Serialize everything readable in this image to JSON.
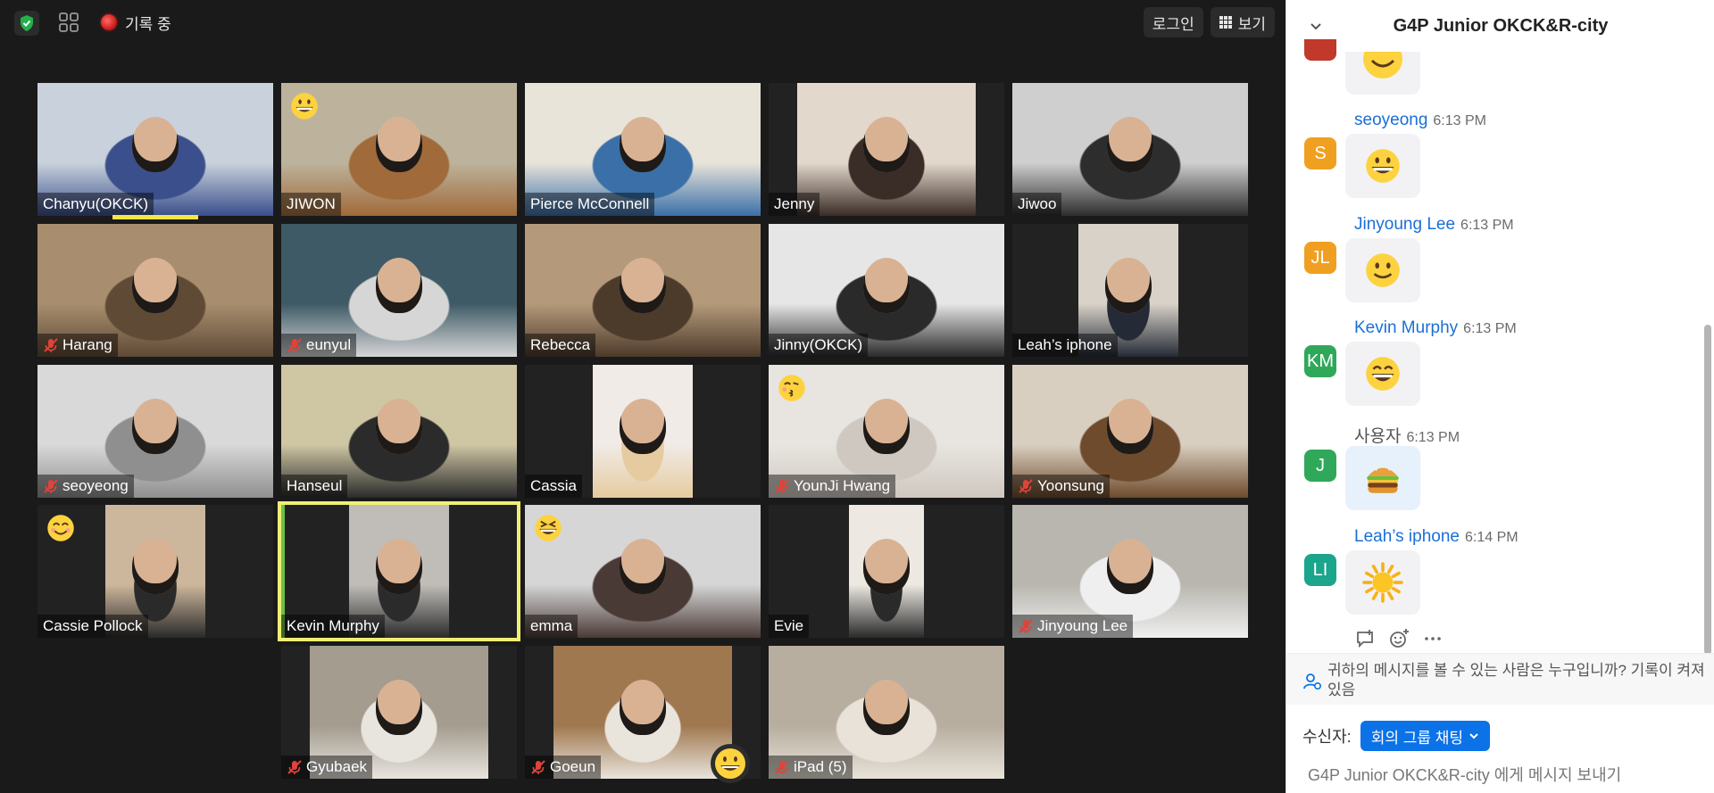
{
  "topbar": {
    "recording_label": "기록 중",
    "login_label": "로그인",
    "view_label": "보기"
  },
  "participants": [
    {
      "name": "Chanyu(OKCK)",
      "muted": false,
      "bg": [
        "#c9d2dc",
        "#3a4f8c"
      ],
      "reaction": ""
    },
    {
      "name": "JIWON",
      "muted": false,
      "bg": [
        "#bdb39c",
        "#a06a3a"
      ],
      "reaction": "grin"
    },
    {
      "name": "Pierce McConnell",
      "muted": false,
      "bg": [
        "#e9e4da",
        "#3a6fa8"
      ],
      "reaction": ""
    },
    {
      "name": "Jenny",
      "muted": false,
      "bg": [
        "#e3d8cc",
        "#3a2c26"
      ],
      "reaction": ""
    },
    {
      "name": "Jiwoo",
      "muted": false,
      "bg": [
        "#cfcfcf",
        "#2d2d2d"
      ],
      "reaction": ""
    },
    {
      "name": "Harang",
      "muted": true,
      "bg": [
        "#a88e6e",
        "#5f4a36"
      ],
      "reaction": ""
    },
    {
      "name": "eunyul",
      "muted": true,
      "bg": [
        "#3e5a66",
        "#d6d6d6"
      ],
      "reaction": ""
    },
    {
      "name": "Rebecca",
      "muted": false,
      "bg": [
        "#b49a7a",
        "#4c3a2a"
      ],
      "reaction": ""
    },
    {
      "name": "Jinny(OKCK)",
      "muted": false,
      "bg": [
        "#e6e6e6",
        "#2a2a2a"
      ],
      "reaction": ""
    },
    {
      "name": "Leah’s iphone",
      "muted": false,
      "bg": [
        "#d8d2c8",
        "#242a36"
      ],
      "reaction": ""
    },
    {
      "name": "seoyeong",
      "muted": true,
      "bg": [
        "#d9d9d9",
        "#8f8f8f"
      ],
      "reaction": ""
    },
    {
      "name": "Hanseul",
      "muted": false,
      "bg": [
        "#cfc6a4",
        "#2b2b2b"
      ],
      "reaction": ""
    },
    {
      "name": "Cassia",
      "muted": false,
      "bg": [
        "#f0ebe6",
        "#e6cba0"
      ],
      "reaction": ""
    },
    {
      "name": "YounJi Hwang",
      "muted": true,
      "bg": [
        "#e8e4df",
        "#cfc8c0"
      ],
      "reaction": "kiss"
    },
    {
      "name": "Yoonsung",
      "muted": true,
      "bg": [
        "#d9cfc0",
        "#6e4b2c"
      ],
      "reaction": ""
    },
    {
      "name": "Cassie Pollock",
      "muted": false,
      "bg": [
        "#cdb79c",
        "#2a2a2a"
      ],
      "reaction": "smile"
    },
    {
      "name": "Kevin Murphy",
      "muted": false,
      "bg": [
        "#c0bdb8",
        "#2b2b2b"
      ],
      "reaction": ""
    },
    {
      "name": "emma",
      "muted": false,
      "bg": [
        "#d6d6d6",
        "#4a3a36"
      ],
      "reaction": "laugh"
    },
    {
      "name": "Evie",
      "muted": false,
      "bg": [
        "#ede9e2",
        "#2a2a2a"
      ],
      "reaction": ""
    },
    {
      "name": "Jinyoung Lee",
      "muted": true,
      "bg": [
        "#b8b6ae",
        "#efefef"
      ],
      "reaction": ""
    },
    {
      "name": "Gyubaek",
      "muted": true,
      "bg": [
        "#a39c8f",
        "#e8e4de"
      ],
      "reaction": ""
    },
    {
      "name": "Goeun",
      "muted": true,
      "bg": [
        "#a07850",
        "#e9e4dc"
      ],
      "reaction": ""
    },
    {
      "name": "iPad (5)",
      "muted": true,
      "bg": [
        "#b7aea0",
        "#e8e2d8"
      ],
      "reaction": ""
    }
  ],
  "chat": {
    "title": "G4P Junior OKCK&R-city",
    "messages": [
      {
        "initials": "S",
        "name": "seoyeong",
        "time": "6:13 PM",
        "avatar_color": "#f0a020",
        "emoji": "grin"
      },
      {
        "initials": "JL",
        "name": "Jinyoung Lee",
        "time": "6:13 PM",
        "avatar_color": "#f0a020",
        "emoji": "slight-smile"
      },
      {
        "initials": "KM",
        "name": "Kevin Murphy",
        "time": "6:13 PM",
        "avatar_color": "#2fa85a",
        "emoji": "big-grin"
      },
      {
        "initials": "J",
        "name": "사용자",
        "time": "6:13 PM",
        "avatar_color": "#2fa85a",
        "emoji": "burger"
      },
      {
        "initials": "LI",
        "name": "Leah’s iphone",
        "time": "6:14 PM",
        "avatar_color": "#1aa58c",
        "emoji": "sun"
      }
    ],
    "notice": "귀하의 메시지를 볼 수 있는 사람은 누구입니까? 기록이 켜져 있음",
    "to_label": "수신자:",
    "to_target": "회의 그룹 채팅",
    "input_placeholder": "G4P Junior OKCK&R-city 에게 메시지 보내기"
  },
  "colors": {
    "accent_blue": "#0b72e7",
    "active_speaker": "#f0ef74",
    "record_red": "#d0201a",
    "shield_green": "#22b04a"
  }
}
